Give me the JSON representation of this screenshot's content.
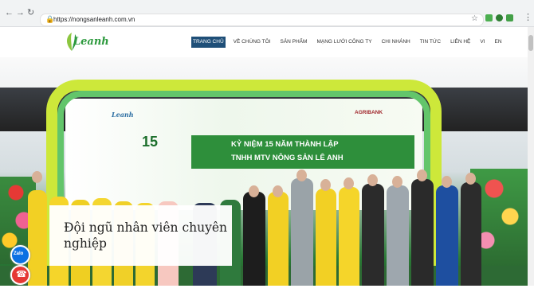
{
  "browser": {
    "url": "https://nongsanleanh.com.vn",
    "back_icon": "arrow-left-icon",
    "forward_icon": "arrow-right-icon",
    "reload_icon": "reload-icon"
  },
  "site": {
    "logo_text": "Leanh",
    "nav": [
      "TRANG CHỦ",
      "VỀ CHÚNG TÔI",
      "SẢN PHẨM",
      "MẠNG LƯỚI CÔNG TY",
      "CHI NHÁNH",
      "TIN TỨC",
      "LIÊN HỆ",
      "VI",
      "EN"
    ]
  },
  "hero": {
    "backdrop_logo": "Leanh",
    "backdrop_bank": "AGRIBANK",
    "backdrop_number": "15",
    "backdrop_title": "KỶ NIỆM 15 NĂM THÀNH LẬP",
    "backdrop_subtitle": "TNHH MTV NÔNG SẢN LÊ ANH",
    "caption": "Đội ngũ nhân viên chuyên nghiệp"
  },
  "floating": {
    "zalo_label": "Zalo"
  },
  "colors": {
    "nav_active": "#1f4f78",
    "brand_green": "#2d9a3e"
  }
}
